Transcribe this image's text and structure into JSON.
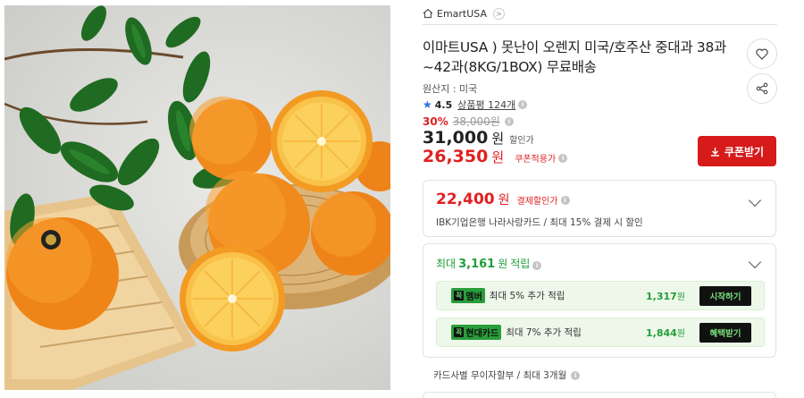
{
  "store": {
    "name": "EmartUSA",
    "chevron": ">"
  },
  "product": {
    "title": "이마트USA ) 못난이 오렌지 미국/호주산 중대과 38과~42과(8KG/1BOX) 무료배송",
    "origin": "원산지 : 미국",
    "rating": {
      "score": "4.5",
      "reviews": "상품평 124개"
    },
    "discount_pct": "30%",
    "original_price": "38,000원",
    "price": "31,000",
    "price_unit": "원",
    "price_tag": "할인가",
    "coupon_price": "26,350",
    "coupon_unit": "원",
    "coupon_tag": "쿠폰적용가",
    "coupon_button": "쿠폰받기"
  },
  "card_offer": {
    "price": "22,400",
    "unit": "원",
    "tag": "결제할인가",
    "desc": "IBK기업은행 나라사랑카드 / 최대 15% 결제 시 할인"
  },
  "points": {
    "prefix": "최대",
    "amount": "3,161",
    "unit": "원",
    "suffix": "적립",
    "benefits": [
      {
        "mark": "꼭",
        "brand": "멤버",
        "text": "최대 5% 추가 적립",
        "amount": "1,317",
        "unit": "원",
        "action": "시작하기"
      },
      {
        "mark": "꼭",
        "brand": "현대카드",
        "text": "최대 7% 추가 적립",
        "amount": "1,844",
        "unit": "원",
        "action": "혜택받기"
      }
    ]
  },
  "installment": "카드사별 무이자할부 / 최대 3개월",
  "icons": [
    "home-icon",
    "heart-icon",
    "share-icon",
    "star-icon",
    "info-icon",
    "download-icon",
    "chevron-down-icon"
  ],
  "colors": {
    "accent_red": "#e02020",
    "button_red": "#d71a1a",
    "points_green": "#1f9e3a",
    "rating_blue": "#2f6fe4"
  }
}
